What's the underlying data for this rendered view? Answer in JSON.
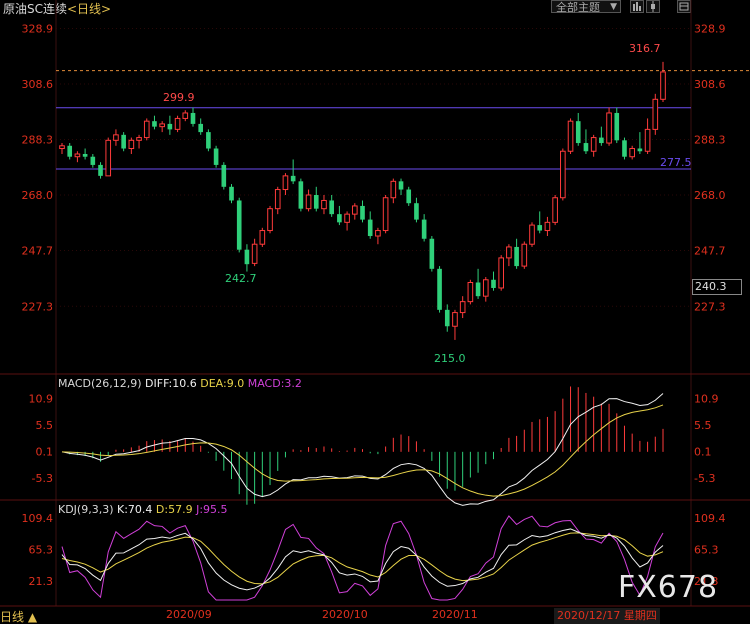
{
  "header": {
    "instrument": "原油SC连续",
    "period": "<日线>",
    "theme_label": "全部主题",
    "dropdown_arrow": "▼",
    "tool_icons": [
      "bar-chart-icon",
      "candle-icon",
      "settings-icon"
    ]
  },
  "price_panel": {
    "y_labels": [
      "328.9",
      "308.6",
      "288.3",
      "268.0",
      "247.7",
      "227.3"
    ],
    "current_price": "240.3",
    "annotations": {
      "high_label": "316.7",
      "left_high_label": "299.9",
      "mid_low_label": "242.7",
      "low_label": "215.0",
      "line_label": "277.5"
    }
  },
  "macd_panel": {
    "name": "MACD(26,12,9)",
    "diff": "DIFF:10.6",
    "dea": "DEA:9.0",
    "macd": "MACD:3.2",
    "y_labels": [
      "10.9",
      "5.5",
      "0.1",
      "-5.3"
    ]
  },
  "kdj_panel": {
    "name": "KDJ(9,3,3)",
    "k": "K:70.4",
    "d": "D:57.9",
    "j": "J:95.5",
    "y_labels": [
      "109.4",
      "65.3",
      "21.3"
    ]
  },
  "x_axis": {
    "labels": [
      "2020/09",
      "2020/10",
      "2020/11"
    ],
    "cursor_date": "2020/12/17 星期四"
  },
  "footer": {
    "period_tag": "日线 ▲",
    "watermark": "FX678"
  },
  "colors": {
    "up": "#ff3b3b",
    "down": "#2fd07a",
    "yellow": "#e8d34a",
    "magenta": "#d040d8",
    "white": "#f0f0f0",
    "purple_line": "#6a4cf0",
    "orange_dash": "#e08a3a"
  },
  "chart_data": {
    "type": "candlestick",
    "price_range": [
      204,
      332
    ],
    "horizontal_lines": [
      299.9,
      277.5
    ],
    "dashed_line": 313.5,
    "candles": [
      [
        285,
        287,
        283,
        286
      ],
      [
        286,
        287,
        281,
        282
      ],
      [
        282,
        284,
        280,
        283
      ],
      [
        283,
        285,
        281,
        282
      ],
      [
        282,
        283,
        278,
        279
      ],
      [
        279,
        280,
        274,
        275
      ],
      [
        275,
        289,
        275,
        288
      ],
      [
        288,
        292,
        286,
        290
      ],
      [
        290,
        291,
        284,
        285
      ],
      [
        285,
        289,
        283,
        288
      ],
      [
        288,
        290,
        285,
        289
      ],
      [
        289,
        296,
        288,
        295
      ],
      [
        295,
        297,
        292,
        293
      ],
      [
        293,
        295,
        291,
        294
      ],
      [
        294,
        297,
        290,
        292
      ],
      [
        292,
        297,
        291,
        296
      ],
      [
        296,
        299,
        295,
        298
      ],
      [
        298,
        300,
        293,
        294
      ],
      [
        294,
        296,
        290,
        291
      ],
      [
        291,
        292,
        284,
        285
      ],
      [
        285,
        286,
        278,
        279
      ],
      [
        279,
        280,
        270,
        271
      ],
      [
        271,
        272,
        265,
        266
      ],
      [
        266,
        267,
        247,
        248
      ],
      [
        248,
        250,
        240,
        242.7
      ],
      [
        243,
        252,
        242,
        250
      ],
      [
        250,
        256,
        249,
        255
      ],
      [
        255,
        264,
        254,
        263
      ],
      [
        263,
        271,
        261,
        270
      ],
      [
        270,
        276,
        268,
        275
      ],
      [
        275,
        281,
        272,
        273
      ],
      [
        273,
        274,
        262,
        263
      ],
      [
        263,
        270,
        262,
        268
      ],
      [
        268,
        271,
        262,
        263
      ],
      [
        263,
        268,
        261,
        266
      ],
      [
        266,
        268,
        260,
        261
      ],
      [
        261,
        264,
        257,
        258
      ],
      [
        258,
        262,
        255,
        261
      ],
      [
        261,
        265,
        259,
        264
      ],
      [
        264,
        266,
        258,
        259
      ],
      [
        259,
        262,
        252,
        253
      ],
      [
        253,
        256,
        250,
        255
      ],
      [
        255,
        268,
        254,
        267
      ],
      [
        267,
        274,
        265,
        273
      ],
      [
        273,
        274,
        268,
        270
      ],
      [
        270,
        271,
        264,
        265
      ],
      [
        265,
        267,
        258,
        259
      ],
      [
        259,
        261,
        251,
        252
      ],
      [
        252,
        253,
        240,
        241
      ],
      [
        241,
        242,
        225,
        226
      ],
      [
        226,
        228,
        218,
        220
      ],
      [
        220,
        226,
        215,
        225
      ],
      [
        225,
        231,
        223,
        229
      ],
      [
        229,
        237,
        228,
        236
      ],
      [
        236,
        241,
        230,
        231
      ],
      [
        231,
        238,
        229,
        237
      ],
      [
        237,
        240,
        233,
        234
      ],
      [
        234,
        246,
        233,
        245
      ],
      [
        245,
        250,
        242,
        249
      ],
      [
        249,
        252,
        241,
        242
      ],
      [
        242,
        251,
        241,
        250
      ],
      [
        250,
        258,
        249,
        257
      ],
      [
        257,
        262,
        254,
        255
      ],
      [
        255,
        260,
        253,
        258
      ],
      [
        258,
        268,
        257,
        267
      ],
      [
        267,
        285,
        266,
        284
      ],
      [
        284,
        296,
        283,
        295
      ],
      [
        295,
        298,
        286,
        287
      ],
      [
        287,
        292,
        283,
        284
      ],
      [
        284,
        290,
        282,
        289
      ],
      [
        289,
        293,
        286,
        287
      ],
      [
        287,
        300,
        286,
        298
      ],
      [
        298,
        300,
        287,
        288
      ],
      [
        288,
        289,
        281,
        282
      ],
      [
        282,
        286,
        281,
        285
      ],
      [
        285,
        291,
        283,
        284
      ],
      [
        284,
        296,
        283,
        292
      ],
      [
        292,
        305,
        290,
        303
      ],
      [
        303,
        316.7,
        302,
        313
      ]
    ]
  }
}
